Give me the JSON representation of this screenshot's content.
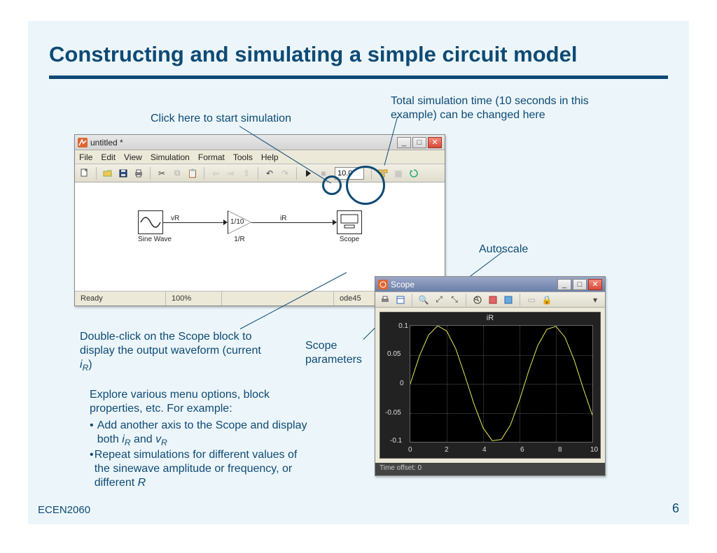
{
  "title": "Constructing and simulating a simple circuit model",
  "footer": {
    "left": "ECEN2060",
    "right": "6"
  },
  "annotations": {
    "click_start": "Click here to start simulation",
    "total_time": "Total simulation time (10 seconds in this example) can be changed here",
    "autoscale": "Autoscale",
    "double_click": "Double-click on the Scope block to display the output waveform (current ",
    "double_click_var": "iR",
    "double_click_end": ")",
    "scope_params": "Scope parameters",
    "explore_head": "Explore various menu options, block properties, etc. For example:",
    "bullet1_a": "Add another axis to the Scope and display both ",
    "bullet1_v1": "iR",
    "bullet1_mid": " and ",
    "bullet1_v2": "vR",
    "bullet2": "Repeat simulations for different values of the sinewave amplitude or frequency, or different ",
    "bullet2_var": "R"
  },
  "main_window": {
    "title": "untitled *",
    "menus": [
      "File",
      "Edit",
      "View",
      "Simulation",
      "Format",
      "Tools",
      "Help"
    ],
    "time_value": "10.0",
    "status": {
      "left": "Ready",
      "zoom": "100%",
      "solver": "ode45"
    },
    "blocks": {
      "sine": "Sine Wave",
      "gain": "1/R",
      "gain_text": "1/10",
      "scope": "Scope",
      "wire_vr": "vR",
      "wire_ir": "iR"
    }
  },
  "scope_window": {
    "title": "Scope",
    "plot_title": "iR",
    "y_ticks": [
      "0.1",
      "0.05",
      "0",
      "-0.05",
      "-0.1"
    ],
    "x_ticks": [
      "0",
      "2",
      "4",
      "6",
      "8",
      "10"
    ],
    "status": "Time offset:   0"
  },
  "chart_data": {
    "type": "line",
    "title": "iR",
    "xlabel": "",
    "ylabel": "",
    "xlim": [
      0,
      10
    ],
    "ylim": [
      -0.1,
      0.1
    ],
    "x": [
      0,
      0.5,
      1,
      1.5,
      2,
      2.5,
      3,
      3.5,
      4,
      4.5,
      5,
      5.5,
      6,
      6.5,
      7,
      7.5,
      8,
      8.5,
      9,
      9.5,
      10
    ],
    "values": [
      0,
      0.048,
      0.084,
      0.1,
      0.091,
      0.06,
      0.014,
      -0.035,
      -0.076,
      -0.098,
      -0.096,
      -0.071,
      -0.028,
      0.022,
      0.066,
      0.094,
      0.099,
      0.08,
      0.041,
      -0.008,
      -0.054
    ]
  }
}
